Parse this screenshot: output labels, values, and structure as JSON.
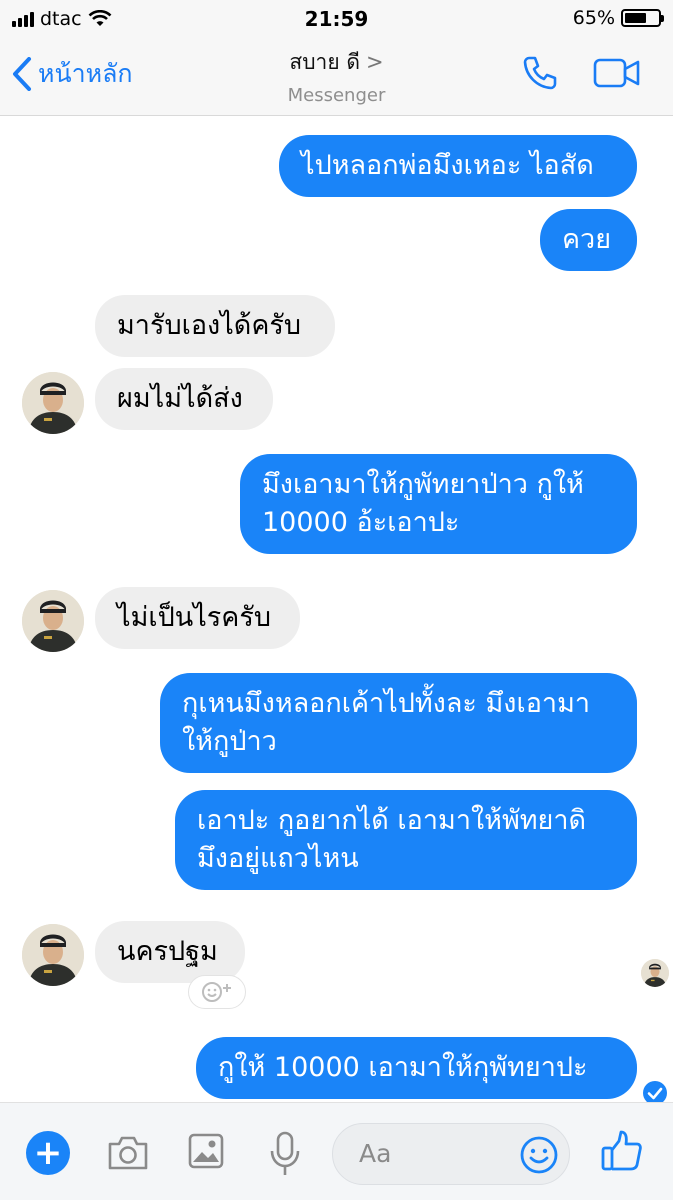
{
  "status_bar": {
    "carrier": "dtac",
    "time": "21:59",
    "battery_percent": "65%",
    "battery_level": 0.65
  },
  "nav": {
    "back_label": "หน้าหลัก",
    "title": "สบาย ดี",
    "subtitle": "Messenger",
    "icons": [
      "back-chevron-icon",
      "phone-icon",
      "video-camera-icon"
    ]
  },
  "messages": [
    {
      "from": "me",
      "text": "ไปหลอกพ่อมึงเหอะ ไอสัด"
    },
    {
      "from": "me",
      "text": "ควย"
    },
    {
      "from": "them",
      "text": "มารับเองได้ครับ"
    },
    {
      "from": "them",
      "text": "ผมไม่ได้ส่ง"
    },
    {
      "from": "me",
      "lines": [
        "มึงเอามาให้กูพัทยาป่าว กูให้",
        "10000 อ้ะเอาปะ"
      ]
    },
    {
      "from": "them",
      "text": "ไม่เป็นไรครับ"
    },
    {
      "from": "me",
      "lines": [
        "กุเหนมึงหลอกเค้าไปทั้งละ มึงเอามา",
        "ให้กูป่าว"
      ]
    },
    {
      "from": "me",
      "lines": [
        "เอาปะ กูอยากได้ เอามาให้พัทยาดิ",
        "มึงอยู่แถวไหน"
      ]
    },
    {
      "from": "them",
      "text": "นครปฐม"
    },
    {
      "from": "me",
      "text": "กูให้ 10000 เอามาให้กุพัทยาปะ"
    }
  ],
  "composer": {
    "placeholder": "Aa",
    "icons": [
      "plus-icon",
      "camera-icon",
      "photo-icon",
      "microphone-icon",
      "emoji-icon",
      "thumbs-up-icon"
    ]
  },
  "colors": {
    "accent": "#1a84f8",
    "incoming_bubble": "#eeeeee",
    "link_blue": "#1a7cf5"
  }
}
